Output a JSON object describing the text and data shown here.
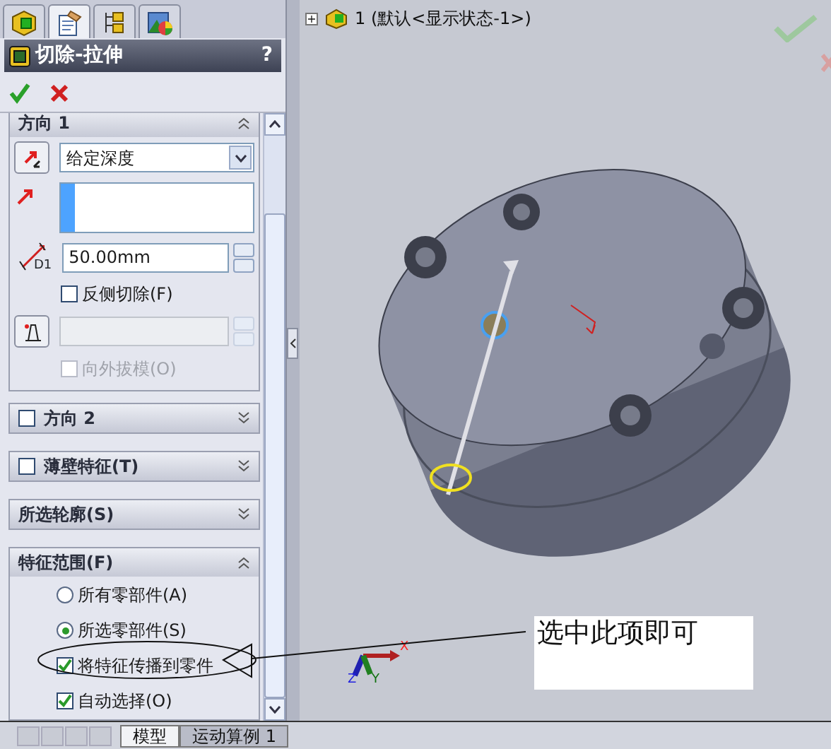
{
  "panel_tabs": [
    {
      "selected": false
    },
    {
      "selected": true
    },
    {
      "selected": false
    },
    {
      "selected": false
    }
  ],
  "feature": {
    "title": "切除-拉伸",
    "help": "?"
  },
  "direction1": {
    "title": "方向 1",
    "expanded": true,
    "end_condition": "给定深度",
    "depth_symbol": "D1",
    "depth": "50.00mm",
    "reverse_cut": {
      "label": "反侧切除(F)",
      "checked": false
    },
    "draft_outward": {
      "label": "向外拔模(O)",
      "checked": false,
      "disabled": true
    }
  },
  "sections": [
    {
      "kind": "optional",
      "label": "方向 2",
      "checked": false,
      "expanded": false
    },
    {
      "kind": "optional",
      "label": "薄壁特征(T)",
      "checked": false,
      "expanded": false
    },
    {
      "kind": "plain",
      "label": "所选轮廓(S)",
      "expanded": false
    }
  ],
  "feature_scope": {
    "title": "特征范围(F)",
    "expanded": true,
    "options": [
      {
        "kind": "radio",
        "label": "所有零部件(A)",
        "selected": false
      },
      {
        "kind": "radio",
        "label": "所选零部件(S)",
        "selected": true
      },
      {
        "kind": "checkbox",
        "label": "将特征传播到零件",
        "checked": true
      },
      {
        "kind": "checkbox",
        "label": "自动选择(O)",
        "checked": true
      }
    ]
  },
  "tree": {
    "expand": "+",
    "label": "1 (默认<显示状态-1>)"
  },
  "callout": {
    "text": "选中此项即可"
  },
  "triad": {
    "x": "X",
    "y": "Y",
    "z": "Z"
  },
  "bottom_tabs": [
    {
      "label": "模型",
      "selected": true
    },
    {
      "label": "运动算例 1",
      "selected": false
    }
  ]
}
